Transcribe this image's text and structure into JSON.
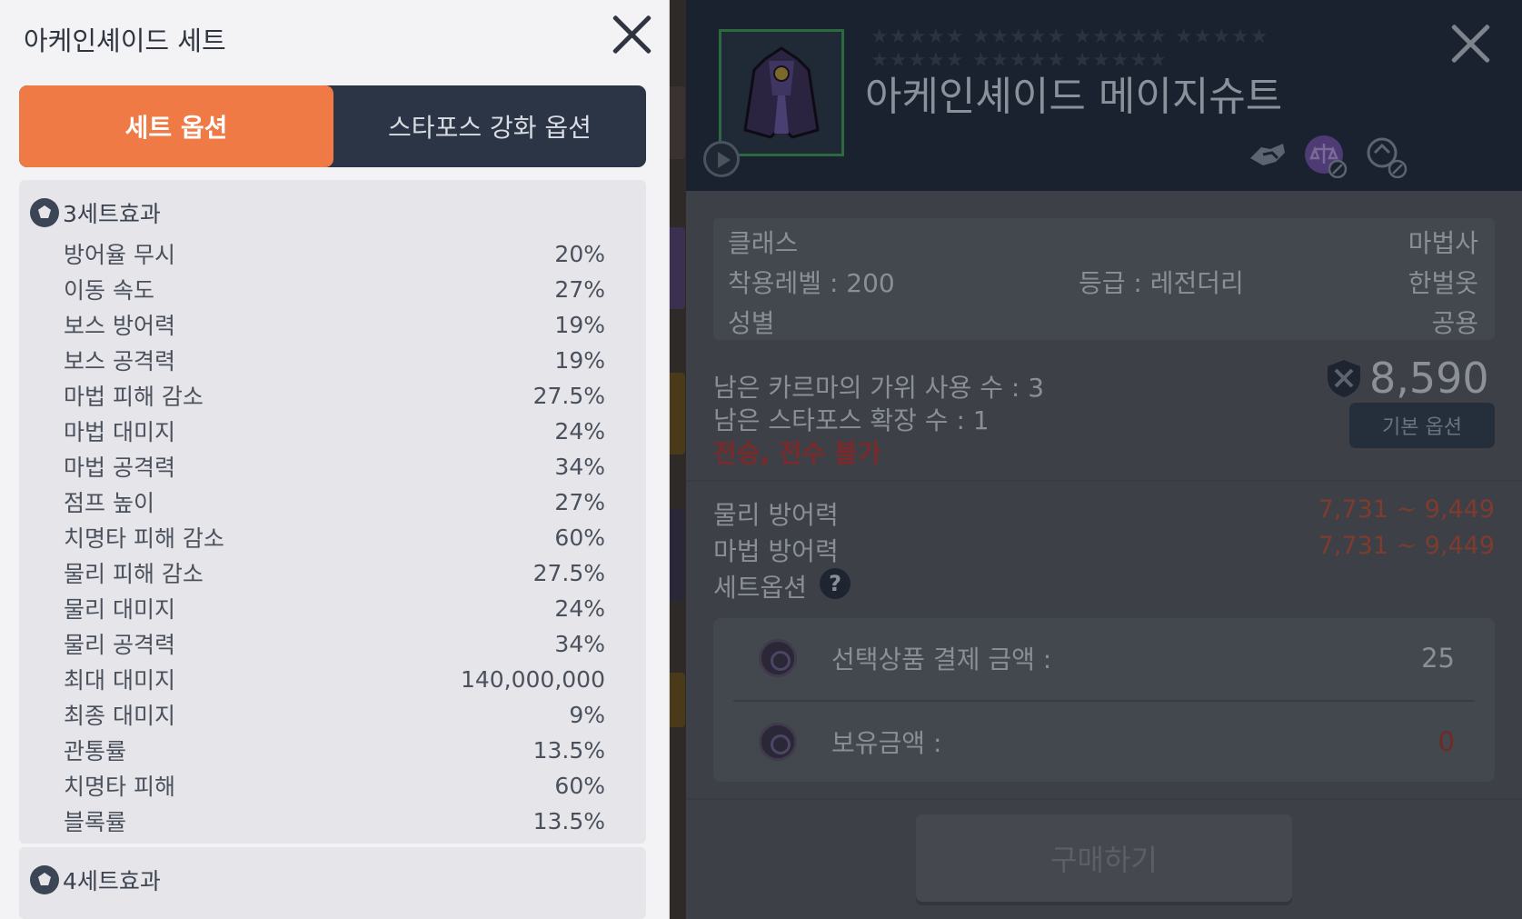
{
  "set_panel": {
    "title": "아케인셰이드 세트",
    "tabs": [
      {
        "label": "세트 옵션",
        "active": true
      },
      {
        "label": "스타포스 강화 옵션",
        "active": false
      }
    ],
    "set3": {
      "label": "3세트효과",
      "options": [
        {
          "name": "방어율 무시",
          "value": "20%"
        },
        {
          "name": "이동 속도",
          "value": "27%"
        },
        {
          "name": "보스 방어력",
          "value": "19%"
        },
        {
          "name": "보스 공격력",
          "value": "19%"
        },
        {
          "name": "마법 피해 감소",
          "value": "27.5%"
        },
        {
          "name": "마법 대미지",
          "value": "24%"
        },
        {
          "name": "마법 공격력",
          "value": "34%"
        },
        {
          "name": "점프 높이",
          "value": "27%"
        },
        {
          "name": "치명타 피해 감소",
          "value": "60%"
        },
        {
          "name": "물리 피해 감소",
          "value": "27.5%"
        },
        {
          "name": "물리 대미지",
          "value": "24%"
        },
        {
          "name": "물리 공격력",
          "value": "34%"
        },
        {
          "name": "최대 대미지",
          "value": "140,000,000"
        },
        {
          "name": "최종 대미지",
          "value": "9%"
        },
        {
          "name": "관통률",
          "value": "13.5%"
        },
        {
          "name": "치명타 피해",
          "value": "60%"
        },
        {
          "name": "블록률",
          "value": "13.5%"
        }
      ]
    },
    "set4": {
      "label": "4세트효과"
    }
  },
  "item_panel": {
    "item_name": "아케인셰이드 메이지슈트",
    "stars_row1": "★★★★★ ★★★★★ ★★★★★ ★★★★★",
    "stars_row2": "★★★★★ ★★★★★ ★★★★★",
    "class_label": "클래스",
    "class_value": "마법사",
    "level_label": "착용레벨 : 200",
    "grade_label": "등급 : 레전더리",
    "slot_value": "한벌옷",
    "gender_label": "성별",
    "gender_value": "공용",
    "karma_uses": "남은 카르마의 가위 사용 수 : 3",
    "starforce_ext": "남은 스타포스 확장 수 : 1",
    "transfer_note": "전승, 전수 불가",
    "price": "8,590",
    "base_option_button": "기본 옵션",
    "phys_def_label": "물리 방어력",
    "phys_def_value": "7,731 ~ 9,449",
    "mag_def_label": "마법 방어력",
    "mag_def_value": "7,731 ~ 9,449",
    "set_option_label": "세트옵션",
    "help_glyph": "?",
    "payment_label": "선택상품 결제 금액 :",
    "payment_value": "25",
    "balance_label": "보유금액 :",
    "balance_value": "0",
    "buy_button": "구매하기"
  },
  "colors": {
    "tab_active": "#f07a45",
    "tab_bar": "#2b3545",
    "red_text": "#7a2a2a",
    "defense_value": "#7e3b2e"
  }
}
